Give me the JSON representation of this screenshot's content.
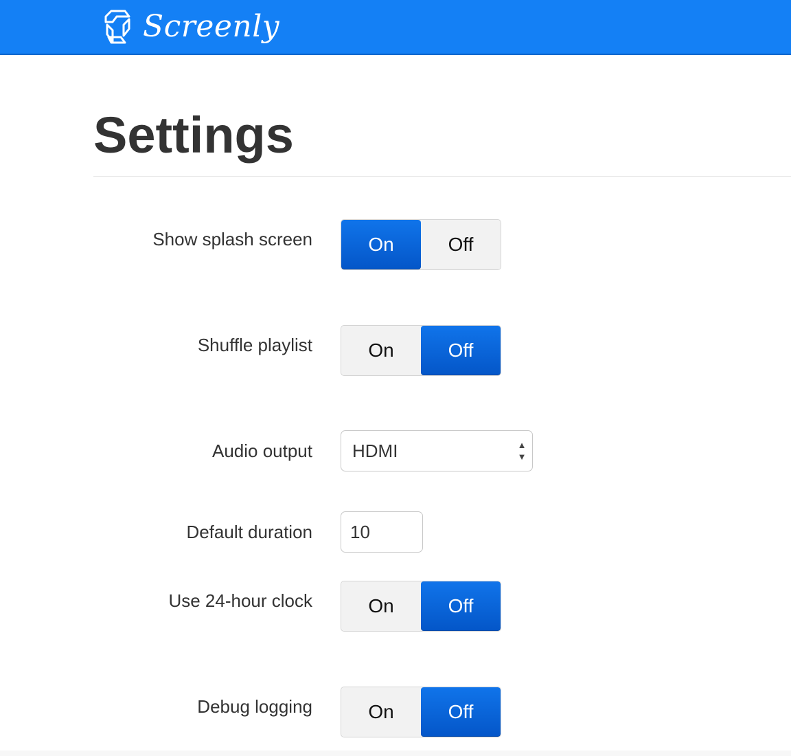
{
  "brand": {
    "name": "Screenly",
    "logo_icon": "screenly-logo-icon",
    "color": "#1480f5"
  },
  "page": {
    "title": "Settings"
  },
  "settings": {
    "show_splash_screen": {
      "label": "Show splash screen",
      "on": "On",
      "off": "Off",
      "value": "On"
    },
    "shuffle_playlist": {
      "label": "Shuffle playlist",
      "on": "On",
      "off": "Off",
      "value": "Off"
    },
    "audio_output": {
      "label": "Audio output",
      "value": "HDMI",
      "icon": "updown-arrows-icon"
    },
    "default_duration": {
      "label": "Default duration",
      "value": "10"
    },
    "use_24_hour_clock": {
      "label": "Use 24-hour clock",
      "on": "On",
      "off": "Off",
      "value": "Off"
    },
    "debug_logging": {
      "label": "Debug logging",
      "on": "On",
      "off": "Off",
      "value": "Off"
    }
  },
  "colors": {
    "active_toggle": "#0a64d8",
    "inactive_toggle": "#f2f2f2",
    "text": "#333333"
  }
}
